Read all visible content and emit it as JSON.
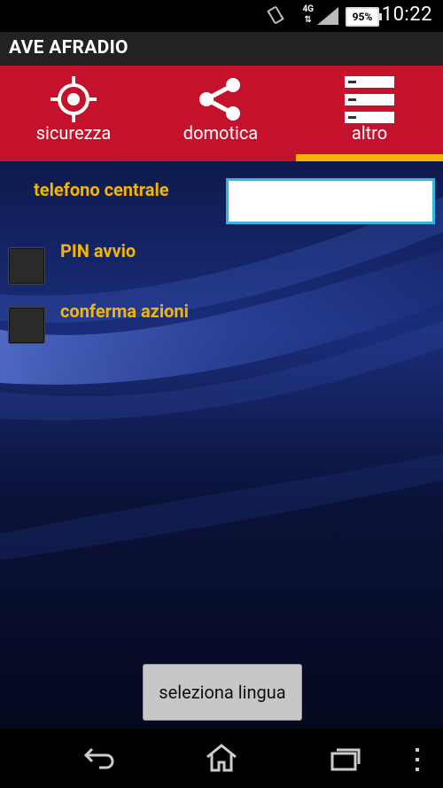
{
  "status_bar": {
    "time": "10:22",
    "battery": "95%",
    "network": "4G",
    "icons": [
      "vibrate-icon",
      "network-4g-icon",
      "signal-icon",
      "battery-icon"
    ]
  },
  "app": {
    "title": "AVE AFRADIO"
  },
  "tabs": [
    {
      "label": "sicurezza",
      "icon": "target-icon",
      "active": false
    },
    {
      "label": "domotica",
      "icon": "share-icon",
      "active": false
    },
    {
      "label": "altro",
      "icon": "list-icon",
      "active": true
    }
  ],
  "settings": {
    "phone_label": "telefono centrale",
    "phone_value": "",
    "pin_label": "PIN avvio",
    "pin_checked": false,
    "confirm_label": "conferma azioni",
    "confirm_checked": false
  },
  "language_button": "seleziona lingua",
  "colors": {
    "tab_bar": "#c4122c",
    "active_indicator": "#f5b400",
    "label_text": "#f5b400",
    "input_focus": "#33b5e5"
  },
  "nav_bar": [
    "back-icon",
    "home-icon",
    "recents-icon",
    "menu-icon"
  ]
}
